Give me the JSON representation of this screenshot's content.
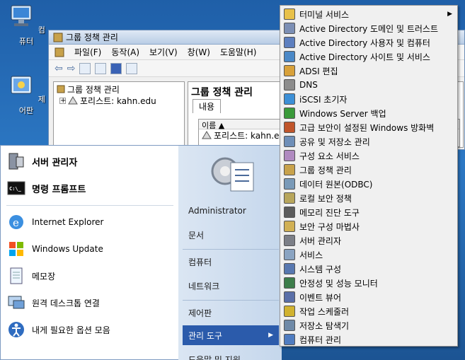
{
  "desktop": {
    "icons": [
      {
        "label": "컴퓨터",
        "icon": "computer-icon"
      },
      {
        "label": "제어판",
        "icon": "control-panel-icon"
      }
    ]
  },
  "gpmc_window": {
    "title": "그룹 정책 관리",
    "menu": [
      "파일(F)",
      "동작(A)",
      "보기(V)",
      "창(W)",
      "도움말(H)"
    ],
    "tree": {
      "root": "그룹 정책 관리",
      "child": "포리스트: kahn.edu"
    },
    "pane": {
      "title": "그룹 정책 관리",
      "tab": "내용",
      "column": "이름",
      "row": "포리스트: kahn.e"
    }
  },
  "start_menu": {
    "pinned": [
      {
        "label": "서버 관리자",
        "icon": "server-manager-icon"
      },
      {
        "label": "명령 프롬프트",
        "icon": "command-prompt-icon"
      }
    ],
    "programs": [
      {
        "label": "Internet Explorer",
        "icon": "internet-explorer-icon"
      },
      {
        "label": "Windows Update",
        "icon": "windows-update-icon"
      },
      {
        "label": "메모장",
        "icon": "notepad-icon"
      },
      {
        "label": "원격 데스크톱 연결",
        "icon": "remote-desktop-icon"
      },
      {
        "label": "내게 필요한 옵션 모음",
        "icon": "accessibility-icon"
      }
    ],
    "right": [
      {
        "label": "Administrator"
      },
      {
        "label": "문서"
      },
      {
        "label": "컴퓨터"
      },
      {
        "label": "네트워크"
      },
      {
        "label": "제어판"
      },
      {
        "label": "관리 도구",
        "selected": true
      },
      {
        "label": "도움말 및 지원"
      }
    ]
  },
  "admin_tools_submenu": {
    "items": [
      {
        "label": "터미널 서비스",
        "icon": "folder-icon",
        "has_submenu": true
      },
      {
        "label": "Active Directory 도메인 및 트러스트",
        "icon": "ad-domains-icon"
      },
      {
        "label": "Active Directory 사용자 및 컴퓨터",
        "icon": "ad-users-icon"
      },
      {
        "label": "Active Directory 사이트 및 서비스",
        "icon": "ad-sites-icon"
      },
      {
        "label": "ADSI 편집",
        "icon": "adsi-edit-icon"
      },
      {
        "label": "DNS",
        "icon": "dns-icon"
      },
      {
        "label": "iSCSI 초기자",
        "icon": "iscsi-icon"
      },
      {
        "label": "Windows Server 백업",
        "icon": "backup-icon"
      },
      {
        "label": "고급 보안이 설정된 Windows 방화벽",
        "icon": "firewall-icon"
      },
      {
        "label": "공유 및 저장소 관리",
        "icon": "share-storage-icon"
      },
      {
        "label": "구성 요소 서비스",
        "icon": "component-services-icon"
      },
      {
        "label": "그룹 정책 관리",
        "icon": "group-policy-icon"
      },
      {
        "label": "데이터 원본(ODBC)",
        "icon": "odbc-icon"
      },
      {
        "label": "로컬 보안 정책",
        "icon": "local-security-icon"
      },
      {
        "label": "메모리 진단 도구",
        "icon": "memory-diagnostic-icon"
      },
      {
        "label": "보안 구성 마법사",
        "icon": "security-wizard-icon"
      },
      {
        "label": "서버 관리자",
        "icon": "server-manager-small-icon"
      },
      {
        "label": "서비스",
        "icon": "services-icon"
      },
      {
        "label": "시스템 구성",
        "icon": "system-config-icon"
      },
      {
        "label": "안정성 및 성능 모니터",
        "icon": "performance-monitor-icon"
      },
      {
        "label": "이벤트 뷰어",
        "icon": "event-viewer-icon"
      },
      {
        "label": "작업 스케줄러",
        "icon": "task-scheduler-icon"
      },
      {
        "label": "저장소 탐색기",
        "icon": "storage-explorer-icon"
      },
      {
        "label": "컴퓨터 관리",
        "icon": "computer-management-icon"
      }
    ]
  },
  "colors": {
    "selected_bg": "#2b5bab",
    "menu_bg": "#f0f0f0",
    "start_right_bg": "#c5d7ec"
  }
}
